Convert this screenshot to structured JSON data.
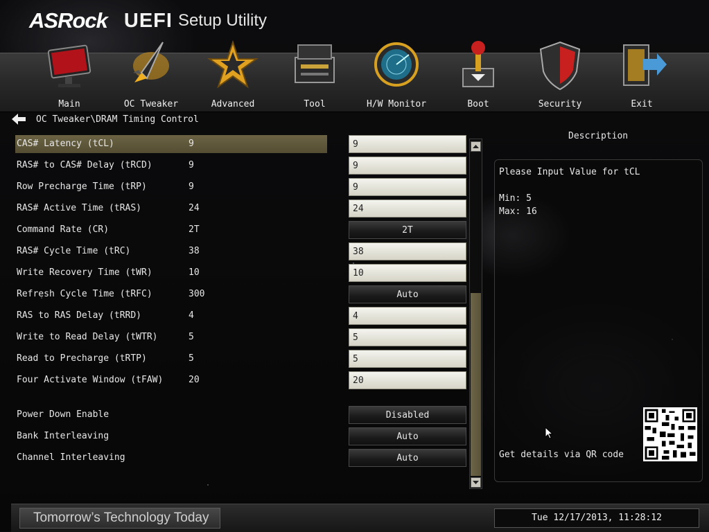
{
  "brand": {
    "logo": "ASRock",
    "uefi": "UEFI",
    "setup": "Setup Utility"
  },
  "tabs": [
    {
      "label": "Main",
      "icon": "monitor-icon"
    },
    {
      "label": "OC Tweaker",
      "icon": "rocket-icon"
    },
    {
      "label": "Advanced",
      "icon": "star-icon"
    },
    {
      "label": "Tool",
      "icon": "toolbox-icon"
    },
    {
      "label": "H/W Monitor",
      "icon": "radar-icon"
    },
    {
      "label": "Boot",
      "icon": "joystick-icon"
    },
    {
      "label": "Security",
      "icon": "shield-icon"
    },
    {
      "label": "Exit",
      "icon": "exit-door-icon"
    }
  ],
  "breadcrumb": "OC Tweaker\\DRAM Timing Control",
  "settings": [
    {
      "name": "CAS# Latency (tCL)",
      "current": "9",
      "value": "9",
      "control": "field"
    },
    {
      "name": "RAS# to CAS# Delay (tRCD)",
      "current": "9",
      "value": "9",
      "control": "field"
    },
    {
      "name": "Row Precharge Time (tRP)",
      "current": "9",
      "value": "9",
      "control": "field"
    },
    {
      "name": "RAS# Active Time (tRAS)",
      "current": "24",
      "value": "24",
      "control": "field"
    },
    {
      "name": "Command Rate (CR)",
      "current": "2T",
      "value": "2T",
      "control": "drop"
    },
    {
      "name": "RAS# Cycle Time (tRC)",
      "current": "38",
      "value": "38",
      "control": "field"
    },
    {
      "name": "Write Recovery Time (tWR)",
      "current": "10",
      "value": "10",
      "control": "field"
    },
    {
      "name": "Refresh Cycle Time (tRFC)",
      "current": "300",
      "value": "Auto",
      "control": "drop"
    },
    {
      "name": "RAS to RAS Delay (tRRD)",
      "current": "4",
      "value": "4",
      "control": "field"
    },
    {
      "name": "Write to Read Delay (tWTR)",
      "current": "5",
      "value": "5",
      "control": "field"
    },
    {
      "name": "Read to Precharge (tRTP)",
      "current": "5",
      "value": "5",
      "control": "field"
    },
    {
      "name": "Four Activate Window (tFAW)",
      "current": "20",
      "value": "20",
      "control": "field"
    },
    {
      "name": "Power Down Enable",
      "current": "",
      "value": "Disabled",
      "control": "drop"
    },
    {
      "name": "Bank Interleaving",
      "current": "",
      "value": "Auto",
      "control": "drop"
    },
    {
      "name": "Channel Interleaving",
      "current": "",
      "value": "Auto",
      "control": "drop"
    }
  ],
  "description": {
    "title": "Description",
    "text": "Please Input Value for tCL",
    "min": "Min: 5",
    "max": "Max: 16",
    "qr_text": "Get details via QR code"
  },
  "footer": {
    "tagline": "Tomorrow’s Technology Today",
    "datetime": "Tue 12/17/2013, 11:28:12"
  },
  "colors": {
    "highlight": "#5f5840",
    "accent_red": "#c8201e",
    "field_bg": "#e6e4d8"
  }
}
